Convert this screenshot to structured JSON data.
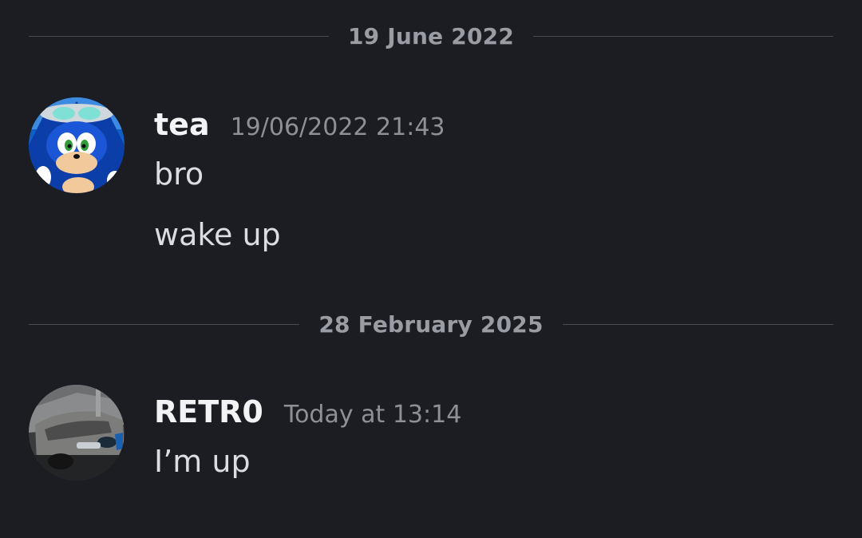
{
  "dividers": [
    {
      "date": "19 June 2022"
    },
    {
      "date": "28 February 2025"
    }
  ],
  "messages": [
    {
      "username": "tea",
      "timestamp": "19/06/2022 21:43",
      "avatar_icon": "sonic-avatar",
      "lines": [
        "bro",
        "wake up"
      ]
    },
    {
      "username": "RETR0",
      "timestamp": "Today at 13:14",
      "avatar_icon": "car-photo-avatar",
      "lines": [
        "I’m up"
      ]
    }
  ],
  "colors": {
    "background": "#1c1d22",
    "username": "#f2f3f5",
    "message_text": "#dcdde1",
    "timestamp": "#8e9097",
    "divider_text": "#9a9ca3",
    "divider_line": "#4a4c53"
  }
}
